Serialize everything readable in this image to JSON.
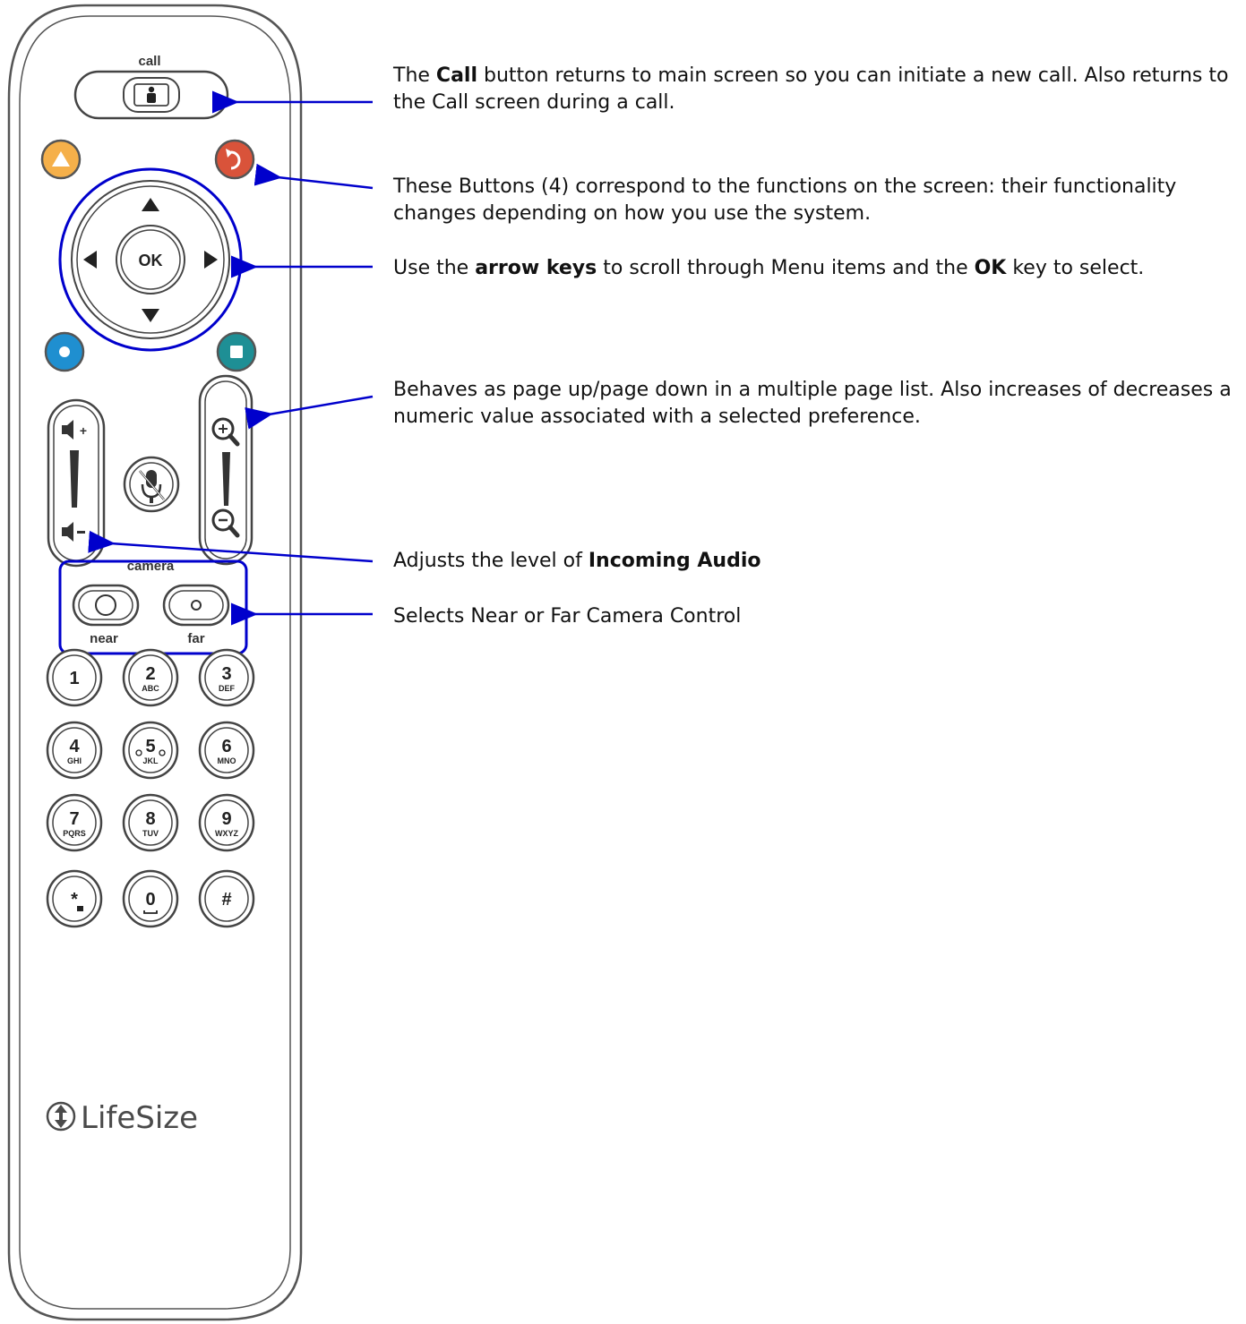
{
  "remote": {
    "call_label": "call",
    "camera_label": "camera",
    "near_label": "near",
    "far_label": "far",
    "ok_label": "OK",
    "brand": "LifeSize",
    "keypad": [
      {
        "digit": "1",
        "letters": ""
      },
      {
        "digit": "2",
        "letters": "ABC"
      },
      {
        "digit": "3",
        "letters": "DEF"
      },
      {
        "digit": "4",
        "letters": "GHI"
      },
      {
        "digit": "5",
        "letters": "JKL"
      },
      {
        "digit": "6",
        "letters": "MNO"
      },
      {
        "digit": "7",
        "letters": "PQRS"
      },
      {
        "digit": "8",
        "letters": "TUV"
      },
      {
        "digit": "9",
        "letters": "WXYZ"
      },
      {
        "digit": "*",
        "letters": ""
      },
      {
        "digit": "0",
        "letters": ""
      },
      {
        "digit": "#",
        "letters": ""
      }
    ],
    "colors": {
      "yellow_button": "#f5b04a",
      "red_button": "#d9533a",
      "blue_button": "#1f8fd0",
      "teal_button": "#1e8f95",
      "callout": "#0000cc"
    }
  },
  "annotations": {
    "call": {
      "pre": "The ",
      "bold": "Call",
      "post": " button returns to main screen so you can initiate a new call. Also returns to the Call screen during a call."
    },
    "function_buttons": {
      "text": "These Buttons (4) correspond to the functions on the screen: their functionality changes depending on how you use the system."
    },
    "arrows": {
      "pre": "Use the ",
      "bold1": "arrow keys",
      "mid": " to scroll through Menu items and the ",
      "bold2": "OK",
      "post": " key to select."
    },
    "page": {
      "text": "Behaves as page up/page down in a multiple page list. Also increases of decreases a numeric value associated with a selected preference."
    },
    "audio": {
      "pre": "Adjusts the level of ",
      "bold": "Incoming Audio"
    },
    "camera": {
      "text": "Selects Near or Far Camera Control"
    }
  }
}
